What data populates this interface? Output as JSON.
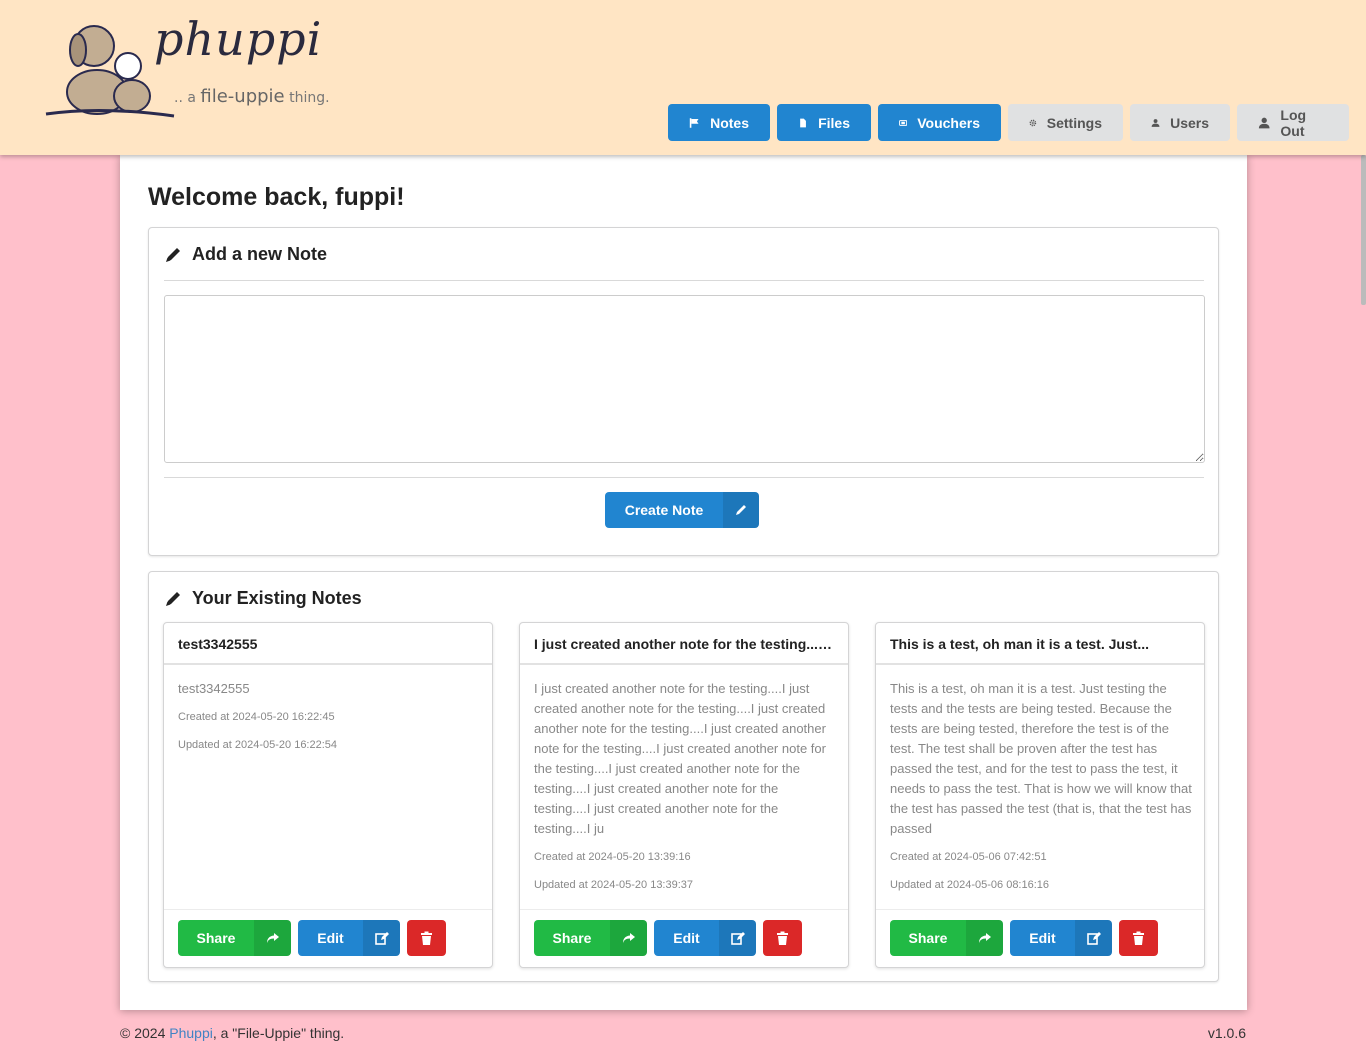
{
  "brand": {
    "name": "phuppi",
    "tagline_prefix": ".. a",
    "tagline_main": "file-uppie",
    "tagline_suffix": "thing."
  },
  "nav": [
    {
      "label": "Notes",
      "icon": "flag-icon",
      "style": "primary"
    },
    {
      "label": "Files",
      "icon": "file-icon",
      "style": "primary"
    },
    {
      "label": "Vouchers",
      "icon": "ticket-icon",
      "style": "primary"
    },
    {
      "label": "Settings",
      "icon": "gear-icon",
      "style": "secondary"
    },
    {
      "label": "Users",
      "icon": "user-icon",
      "style": "secondary"
    },
    {
      "label": "Log Out",
      "icon": "user-icon",
      "style": "secondary"
    }
  ],
  "welcome": "Welcome back, fuppi!",
  "add_note": {
    "heading": "Add a new Note",
    "textarea_value": "",
    "create_label": "Create Note"
  },
  "existing": {
    "heading": "Your Existing Notes",
    "notes": [
      {
        "title": "test3342555",
        "body": "test3342555",
        "created": "Created at 2024-05-20 16:22:45",
        "updated": "Updated at 2024-05-20 16:22:54"
      },
      {
        "title": "I just created another note for the testing....I...",
        "body": "I just created another note for the testing....I just created another note for the testing....I just created another note for the testing....I just created another note for the testing....I just created another note for the testing....I just created another note for the testing....I just created another note for the testing....I just created another note for the testing....I ju",
        "created": "Created at 2024-05-20 13:39:16",
        "updated": "Updated at 2024-05-20 13:39:37"
      },
      {
        "title": "This is a test, oh man it is a test. Just...",
        "body": "This is a test, oh man it is a test. Just testing the tests and the tests are being tested. Because the tests are being tested, therefore the test is of the test. The test shall be proven after the test has passed the test, and for the test to pass the test, it needs to pass the test. That is how we will know that the test has passed the test (that is, that the test has passed",
        "created": "Created at 2024-05-06 07:42:51",
        "updated": "Updated at 2024-05-06 08:16:16"
      }
    ],
    "share_label": "Share",
    "edit_label": "Edit"
  },
  "footer": {
    "copyright_prefix": "© 2024 ",
    "link": "Phuppi",
    "copyright_suffix": ", a \"File-Uppie\" thing.",
    "version": "v1.0.6"
  },
  "colors": {
    "page_bg": "#ffc0cb",
    "header_bg": "#ffe5c4",
    "primary": "#2185d0",
    "success": "#21ba45",
    "danger": "#db2828"
  }
}
